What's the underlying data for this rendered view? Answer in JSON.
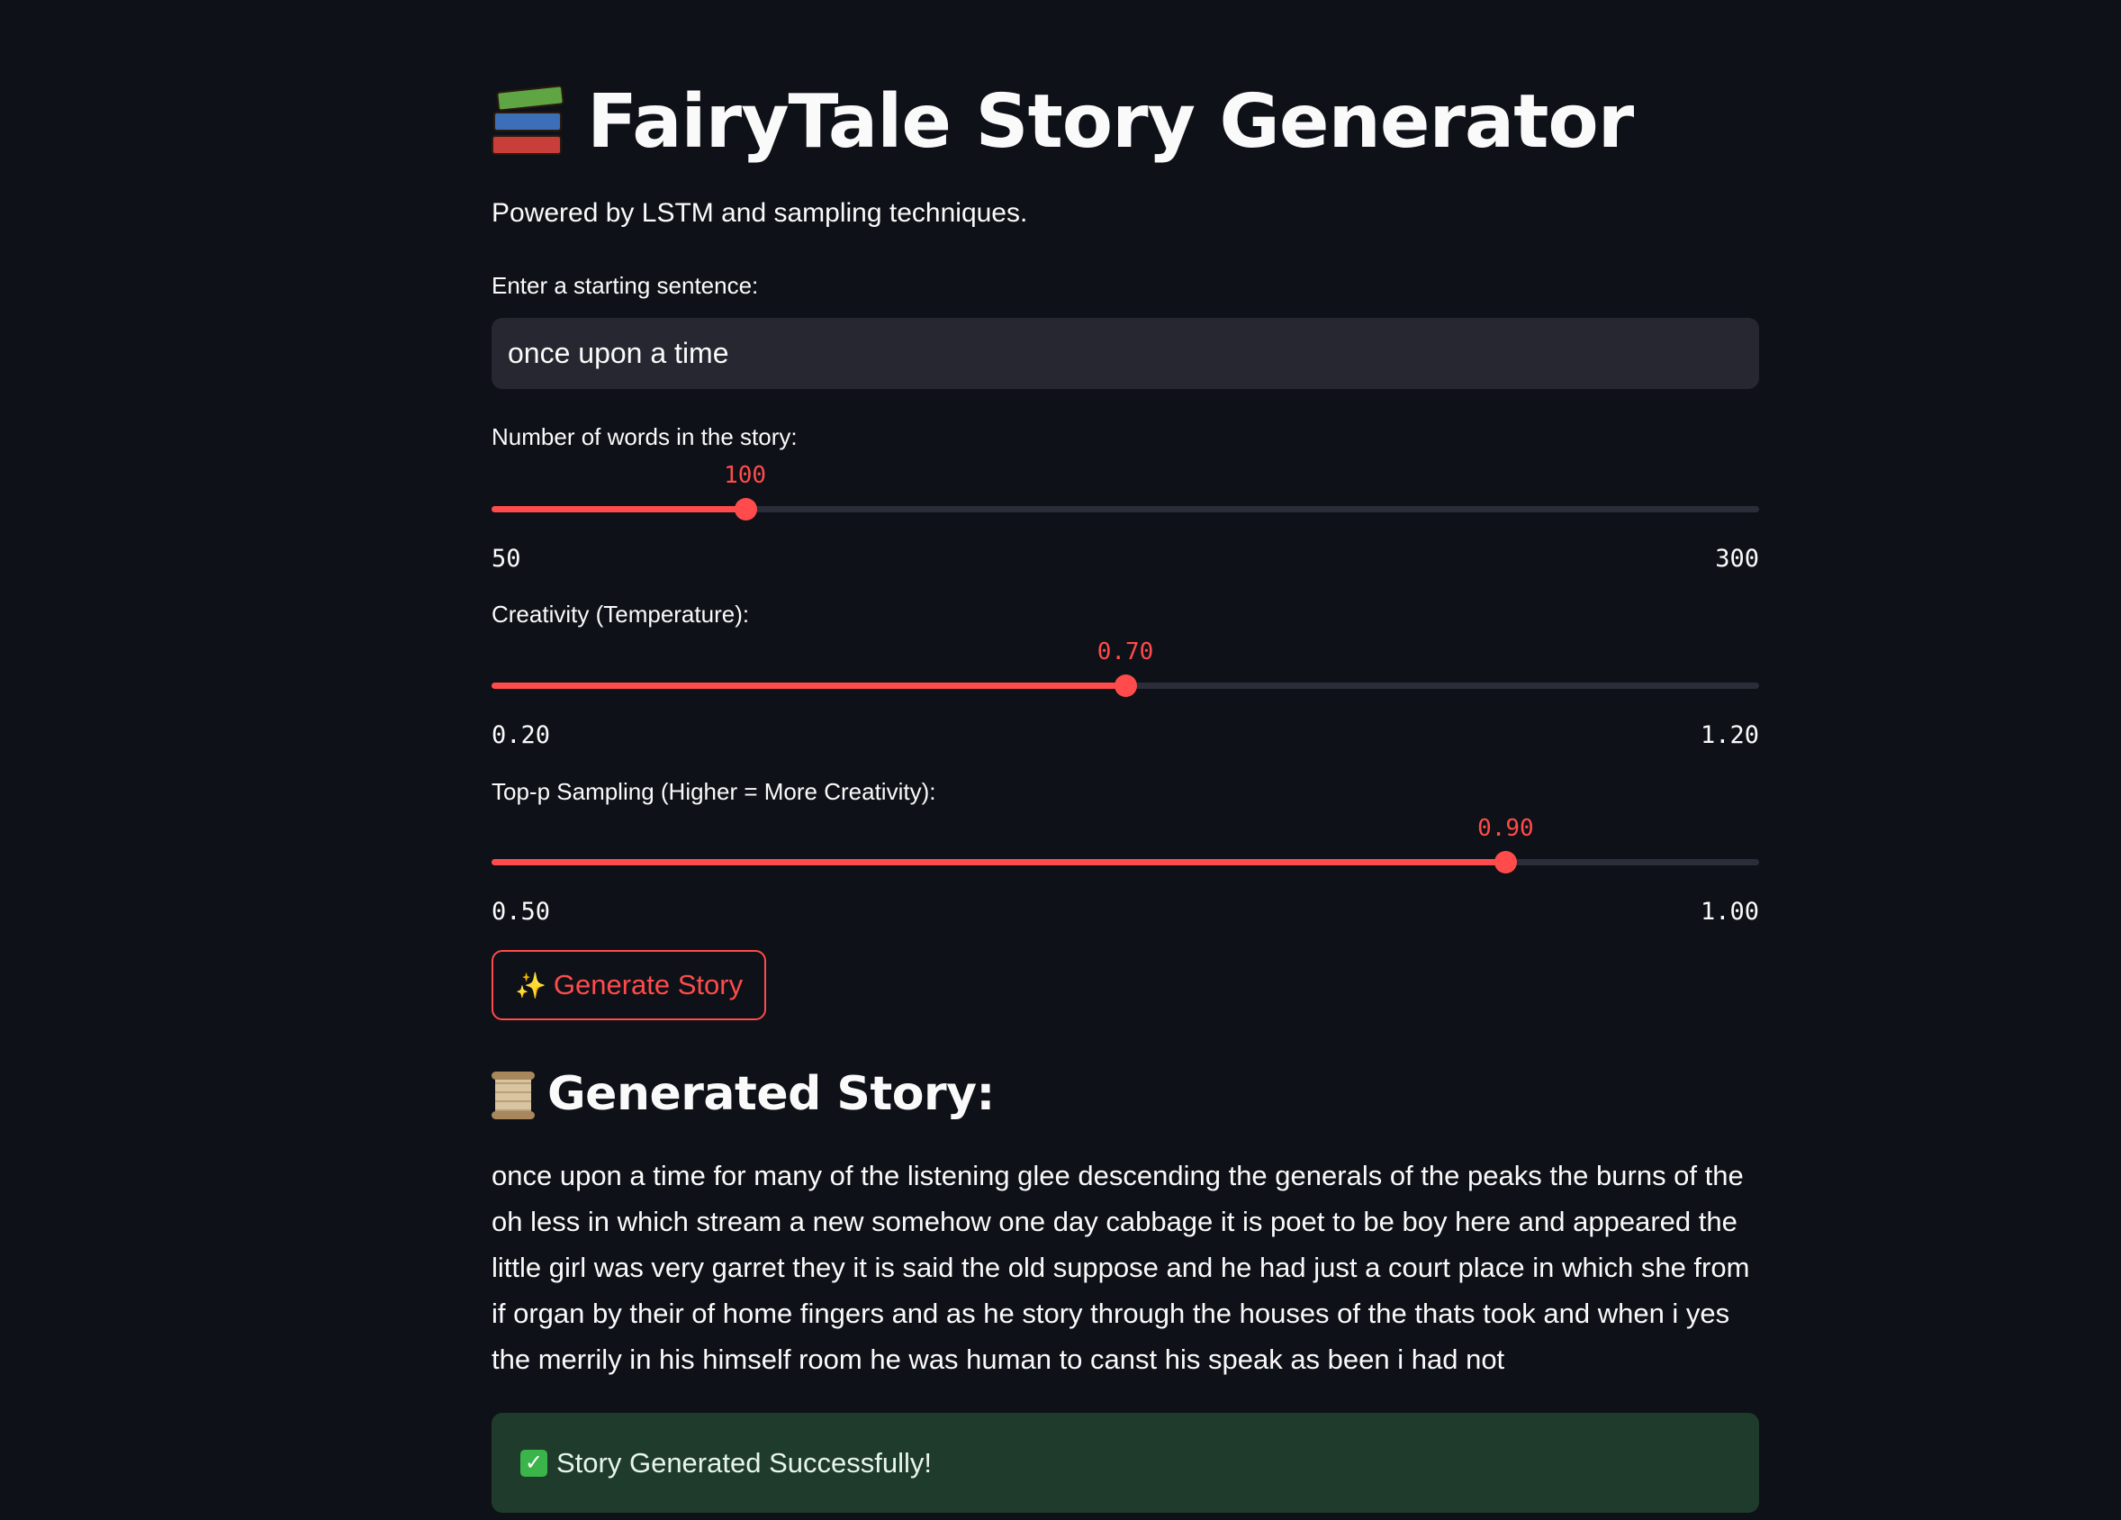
{
  "app": {
    "title": "FairyTale Story Generator",
    "title_icon": "books-icon",
    "subtitle": "Powered by LSTM and sampling techniques."
  },
  "start_input": {
    "label": "Enter a starting sentence:",
    "value": "once upon a time"
  },
  "sliders": [
    {
      "label": "Number of words in the story:",
      "value": 100,
      "value_text": "100",
      "min": 50,
      "max": 300,
      "min_text": "50",
      "max_text": "300"
    },
    {
      "label": "Creativity (Temperature):",
      "value": 0.7,
      "value_text": "0.70",
      "min": 0.2,
      "max": 1.2,
      "min_text": "0.20",
      "max_text": "1.20"
    },
    {
      "label": "Top-p Sampling (Higher = More Creativity):",
      "value": 0.9,
      "value_text": "0.90",
      "min": 0.5,
      "max": 1.0,
      "min_text": "0.50",
      "max_text": "1.00"
    }
  ],
  "generate_button": {
    "icon": "sparkles-icon",
    "label": "Generate Story"
  },
  "result": {
    "heading_icon": "scroll-icon",
    "heading": "Generated Story:",
    "story": "once upon a time for many of the listening glee descending the generals of the peaks the burns of the oh less in which stream a new somehow one day cabbage it is poet to be boy here and appeared the little girl was very garret they it is said the old suppose and he had just a court place in which she from if organ by their of home fingers and as he story through the houses of the thats took and when i yes the merrily in his himself room he was human to canst his speak as been i had not"
  },
  "status": {
    "icon": "check-mark-icon",
    "message": "Story Generated Successfully!"
  },
  "colors": {
    "background": "#0e1117",
    "accent": "#ff4b4b",
    "input_bg": "#262730",
    "success_bg": "#1f3b2c"
  }
}
